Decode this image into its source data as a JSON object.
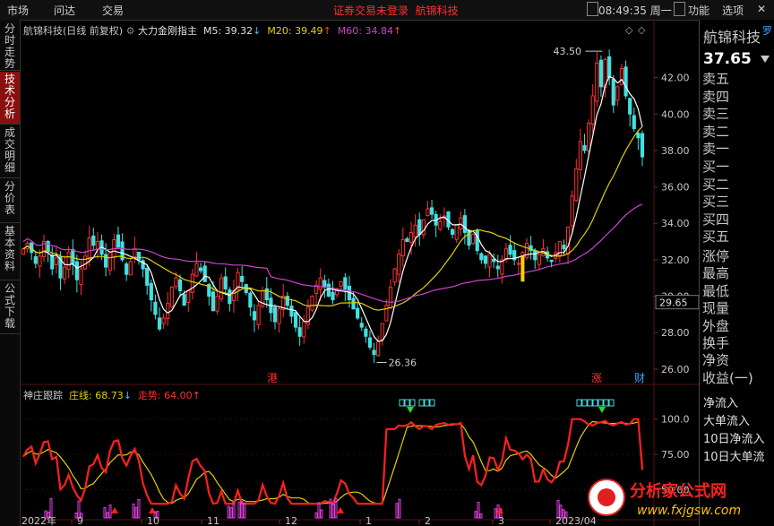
{
  "menu": {
    "market": "市场",
    "ask": "问达",
    "trade": "交易",
    "func": "功能",
    "options": "选项",
    "close": "✕"
  },
  "header_center": {
    "warn": "证券交易未登录",
    "stock": "航锦科技"
  },
  "clock": "08:49:35 周一",
  "left_tabs": [
    "分时走势",
    "技术分析",
    "成交明细",
    "分价表",
    "基本资料",
    "公式下载"
  ],
  "main_legend": {
    "title": "航锦科技(日线 前复权)",
    "indicator": "大力金刚指主",
    "m5": "M5: 39.32",
    "m20": "M20: 39.49",
    "m60": "M60: 34.84"
  },
  "sub_legend": {
    "title": "神庄跟踪",
    "zx": "庄线: 68.73",
    "zs": "走势: 64.00"
  },
  "markers": {
    "high": "43.50",
    "low": "26.36",
    "gang": "港",
    "zhang": "涨",
    "cai": "财",
    "current": "29.65"
  },
  "price_axis": [
    "42.00",
    "40.00",
    "38.00",
    "36.00",
    "34.00",
    "32.00",
    "30.00",
    "28.00",
    "26.00"
  ],
  "sub_axis": [
    "100.0",
    "75.00",
    "50.00"
  ],
  "x_axis": [
    "2022年",
    "9",
    "10",
    "11",
    "12",
    "1",
    "2",
    "3",
    "2023/04"
  ],
  "right_panel": {
    "name": "航锦科技",
    "tag": "罗",
    "price": "37.65",
    "orders": [
      "卖五",
      "卖四",
      "卖三",
      "卖二",
      "卖一",
      "买一",
      "买二",
      "买三",
      "买四",
      "买五"
    ],
    "stats": [
      "涨停",
      "最高",
      "最低",
      "现量",
      "外盘",
      "换手",
      "净资",
      "收益(一)"
    ],
    "flows": [
      "净流入",
      "大单流入",
      "10日净流入",
      "10日大单流"
    ]
  },
  "watermark": {
    "cn": "分析家公式网",
    "url": "www.fxjgsw.com"
  },
  "chart_data": {
    "type": "candlestick",
    "price_ylim": [
      25.5,
      44
    ],
    "closes": [
      32.6,
      32.9,
      32.4,
      31.8,
      32.2,
      33.0,
      32.5,
      31.5,
      32.1,
      31.0,
      31.6,
      32.4,
      31.8,
      30.9,
      31.5,
      32.2,
      33.2,
      32.8,
      33.0,
      32.3,
      31.6,
      32.4,
      33.1,
      32.7,
      32.0,
      31.2,
      31.9,
      32.6,
      32.0,
      31.5,
      30.6,
      29.8,
      29.0,
      28.2,
      28.8,
      29.6,
      30.5,
      31.0,
      30.3,
      29.5,
      30.3,
      31.2,
      31.8,
      31.4,
      30.8,
      30.0,
      29.2,
      30.0,
      31.0,
      30.4,
      29.6,
      30.3,
      31.3,
      30.8,
      30.2,
      29.4,
      28.7,
      29.5,
      30.3,
      29.8,
      29.1,
      28.6,
      29.3,
      30.0,
      29.5,
      28.9,
      28.3,
      27.8,
      28.6,
      29.4,
      30.0,
      30.6,
      31.0,
      30.5,
      30.0,
      29.8,
      30.3,
      30.8,
      30.4,
      29.8,
      29.3,
      28.8,
      28.3,
      27.8,
      27.2,
      26.8,
      27.5,
      28.5,
      29.5,
      30.5,
      31.5,
      32.3,
      33.1,
      33.0,
      33.5,
      33.9,
      33.4,
      34.2,
      34.8,
      34.5,
      33.9,
      34.1,
      34.4,
      33.8,
      33.4,
      33.9,
      34.3,
      33.5,
      32.8,
      33.4,
      32.5,
      32.0,
      31.8,
      32.3,
      31.9,
      31.5,
      32.0,
      32.6,
      32.3,
      32.0,
      31.8,
      32.4,
      32.9,
      32.5,
      32.0,
      32.3,
      32.6,
      32.1,
      31.9,
      32.4,
      33.0,
      32.6,
      33.8,
      35.5,
      37.0,
      38.5,
      38.0,
      39.5,
      41.0,
      42.8,
      41.5,
      43.0,
      42.0,
      40.5,
      41.5,
      42.5,
      41.0,
      40.0,
      39.2,
      38.7,
      37.65
    ],
    "ma5_last": 39.32,
    "ma20_last": 39.49,
    "ma60_last": 34.84,
    "sub_ylim": [
      35,
      110
    ],
    "zhuangxian_last": 68.73,
    "zoushi_last": 64.0
  }
}
